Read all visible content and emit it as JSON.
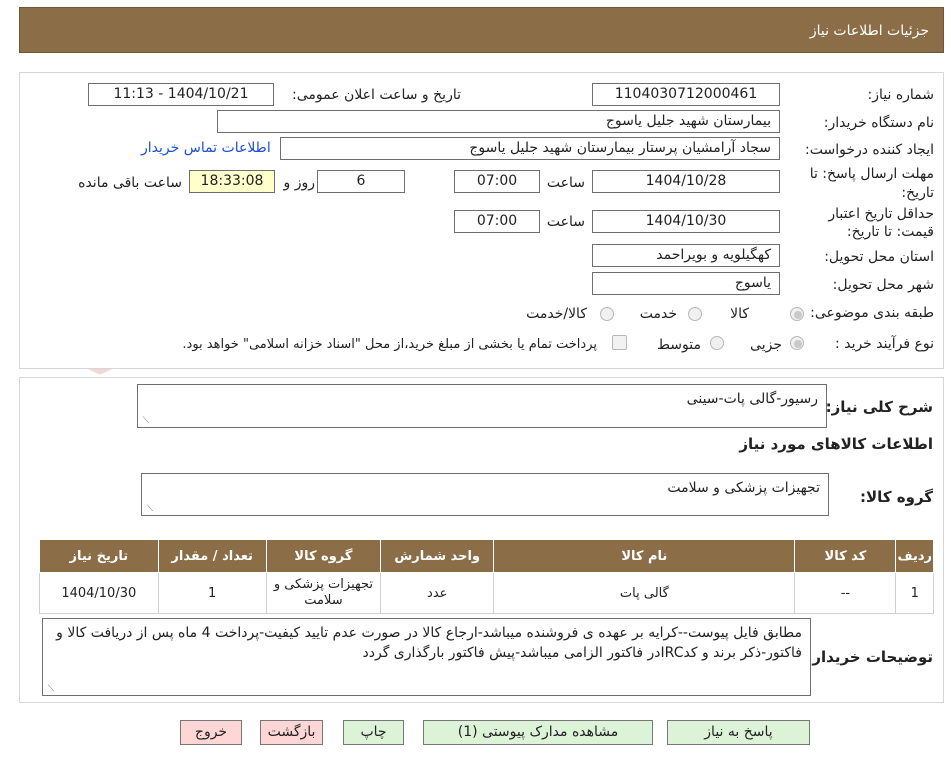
{
  "header": {
    "title": "جزئیات اطلاعات نیاز"
  },
  "watermark": {
    "text": "AriaTender.neT"
  },
  "form": {
    "need_number_label": "شماره نیاز:",
    "need_number": "1104030712000461",
    "announce_label": "تاریخ و ساعت اعلان عمومی:",
    "announce_value": "1404/10/21 - 11:13",
    "buyer_org_label": "نام دستگاه خریدار:",
    "buyer_org": "بیمارستان شهید جلیل یاسوج",
    "creator_label": "ایجاد کننده درخواست:",
    "creator": "سجاد آرامشیان پرستار بیمارستان شهید جلیل یاسوج",
    "contact_link": "اطلاعات تماس خریدار",
    "deadline_label_1": "مهلت ارسال پاسخ: تا",
    "deadline_label_2": "تاریخ:",
    "deadline_date": "1404/10/28",
    "time_label": "ساعت",
    "deadline_time": "07:00",
    "days_value": "6",
    "days_label": "روز و",
    "remaining_time": "18:33:08",
    "remaining_label": "ساعت باقی مانده",
    "validity_label_1": "حداقل تاریخ اعتبار",
    "validity_label_2": "قیمت: تا تاریخ:",
    "validity_date": "1404/10/30",
    "validity_time": "07:00",
    "province_label": "استان محل تحویل:",
    "province": "کهگیلویه و بویراحمد",
    "city_label": "شهر محل تحویل:",
    "city": "یاسوج",
    "category_label": "طبقه بندی موضوعی:",
    "category_options": [
      "کالا",
      "خدمت",
      "کالا/خدمت"
    ],
    "process_label": "نوع فرآیند خرید :",
    "process_options": [
      "جزیی",
      "متوسط"
    ],
    "treasury_note": "پرداخت تمام یا بخشی از مبلغ خرید،از محل \"اسناد خزانه اسلامی\" خواهد بود."
  },
  "details": {
    "general_desc_label": "شرح کلی نیاز:",
    "general_desc": "رسیور-گالی پات-سینی",
    "goods_info_title": "اطلاعات کالاهای مورد نیاز",
    "goods_group_label": "گروه کالا:",
    "goods_group": "تجهیزات پزشکی و سلامت",
    "table": {
      "headers": [
        "ردیف",
        "کد کالا",
        "نام کالا",
        "واحد شمارش",
        "گروه کالا",
        "تعداد / مقدار",
        "تاریخ نیاز"
      ],
      "rows": [
        [
          "1",
          "--",
          "گالی پات",
          "عدد",
          "تجهیزات پزشکی و سلامت",
          "1",
          "1404/10/30"
        ]
      ]
    },
    "buyer_notes_label": "توضیحات خریدار:",
    "buyer_notes": "مطابق فایل پیوست--کرایه بر عهده ی فروشنده میباشد-ارجاع کالا در صورت عدم تایید کیفیت-پرداخت 4 ماه پس از دریافت کالا و فاکتور-ذکر برند و کدIRCدر فاکتور الزامی میباشد-پیش فاکتور بارگذاری گردد"
  },
  "buttons": {
    "reply": "پاسخ به نیاز",
    "attachments": "مشاهده مدارک پیوستی (1)",
    "print": "چاپ",
    "back": "بازگشت",
    "exit": "خروج"
  },
  "colors": {
    "header": "#8b6d47",
    "link": "#1a4fd6",
    "time_bg": "#ffffcc",
    "green_button": "#dcf3d8",
    "pink_button": "#ffd6d6"
  }
}
